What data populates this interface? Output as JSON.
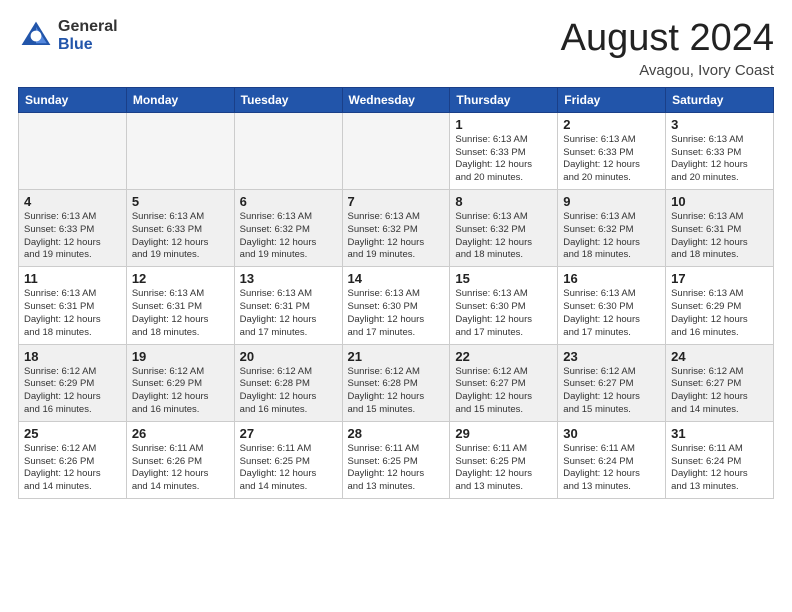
{
  "header": {
    "logo_general": "General",
    "logo_blue": "Blue",
    "month_year": "August 2024",
    "location": "Avagou, Ivory Coast"
  },
  "days_of_week": [
    "Sunday",
    "Monday",
    "Tuesday",
    "Wednesday",
    "Thursday",
    "Friday",
    "Saturday"
  ],
  "weeks": [
    {
      "shaded": false,
      "days": [
        {
          "num": "",
          "detail": ""
        },
        {
          "num": "",
          "detail": ""
        },
        {
          "num": "",
          "detail": ""
        },
        {
          "num": "",
          "detail": ""
        },
        {
          "num": "1",
          "detail": "Sunrise: 6:13 AM\nSunset: 6:33 PM\nDaylight: 12 hours\nand 20 minutes."
        },
        {
          "num": "2",
          "detail": "Sunrise: 6:13 AM\nSunset: 6:33 PM\nDaylight: 12 hours\nand 20 minutes."
        },
        {
          "num": "3",
          "detail": "Sunrise: 6:13 AM\nSunset: 6:33 PM\nDaylight: 12 hours\nand 20 minutes."
        }
      ]
    },
    {
      "shaded": true,
      "days": [
        {
          "num": "4",
          "detail": "Sunrise: 6:13 AM\nSunset: 6:33 PM\nDaylight: 12 hours\nand 19 minutes."
        },
        {
          "num": "5",
          "detail": "Sunrise: 6:13 AM\nSunset: 6:33 PM\nDaylight: 12 hours\nand 19 minutes."
        },
        {
          "num": "6",
          "detail": "Sunrise: 6:13 AM\nSunset: 6:32 PM\nDaylight: 12 hours\nand 19 minutes."
        },
        {
          "num": "7",
          "detail": "Sunrise: 6:13 AM\nSunset: 6:32 PM\nDaylight: 12 hours\nand 19 minutes."
        },
        {
          "num": "8",
          "detail": "Sunrise: 6:13 AM\nSunset: 6:32 PM\nDaylight: 12 hours\nand 18 minutes."
        },
        {
          "num": "9",
          "detail": "Sunrise: 6:13 AM\nSunset: 6:32 PM\nDaylight: 12 hours\nand 18 minutes."
        },
        {
          "num": "10",
          "detail": "Sunrise: 6:13 AM\nSunset: 6:31 PM\nDaylight: 12 hours\nand 18 minutes."
        }
      ]
    },
    {
      "shaded": false,
      "days": [
        {
          "num": "11",
          "detail": "Sunrise: 6:13 AM\nSunset: 6:31 PM\nDaylight: 12 hours\nand 18 minutes."
        },
        {
          "num": "12",
          "detail": "Sunrise: 6:13 AM\nSunset: 6:31 PM\nDaylight: 12 hours\nand 18 minutes."
        },
        {
          "num": "13",
          "detail": "Sunrise: 6:13 AM\nSunset: 6:31 PM\nDaylight: 12 hours\nand 17 minutes."
        },
        {
          "num": "14",
          "detail": "Sunrise: 6:13 AM\nSunset: 6:30 PM\nDaylight: 12 hours\nand 17 minutes."
        },
        {
          "num": "15",
          "detail": "Sunrise: 6:13 AM\nSunset: 6:30 PM\nDaylight: 12 hours\nand 17 minutes."
        },
        {
          "num": "16",
          "detail": "Sunrise: 6:13 AM\nSunset: 6:30 PM\nDaylight: 12 hours\nand 17 minutes."
        },
        {
          "num": "17",
          "detail": "Sunrise: 6:13 AM\nSunset: 6:29 PM\nDaylight: 12 hours\nand 16 minutes."
        }
      ]
    },
    {
      "shaded": true,
      "days": [
        {
          "num": "18",
          "detail": "Sunrise: 6:12 AM\nSunset: 6:29 PM\nDaylight: 12 hours\nand 16 minutes."
        },
        {
          "num": "19",
          "detail": "Sunrise: 6:12 AM\nSunset: 6:29 PM\nDaylight: 12 hours\nand 16 minutes."
        },
        {
          "num": "20",
          "detail": "Sunrise: 6:12 AM\nSunset: 6:28 PM\nDaylight: 12 hours\nand 16 minutes."
        },
        {
          "num": "21",
          "detail": "Sunrise: 6:12 AM\nSunset: 6:28 PM\nDaylight: 12 hours\nand 15 minutes."
        },
        {
          "num": "22",
          "detail": "Sunrise: 6:12 AM\nSunset: 6:27 PM\nDaylight: 12 hours\nand 15 minutes."
        },
        {
          "num": "23",
          "detail": "Sunrise: 6:12 AM\nSunset: 6:27 PM\nDaylight: 12 hours\nand 15 minutes."
        },
        {
          "num": "24",
          "detail": "Sunrise: 6:12 AM\nSunset: 6:27 PM\nDaylight: 12 hours\nand 14 minutes."
        }
      ]
    },
    {
      "shaded": false,
      "days": [
        {
          "num": "25",
          "detail": "Sunrise: 6:12 AM\nSunset: 6:26 PM\nDaylight: 12 hours\nand 14 minutes."
        },
        {
          "num": "26",
          "detail": "Sunrise: 6:11 AM\nSunset: 6:26 PM\nDaylight: 12 hours\nand 14 minutes."
        },
        {
          "num": "27",
          "detail": "Sunrise: 6:11 AM\nSunset: 6:25 PM\nDaylight: 12 hours\nand 14 minutes."
        },
        {
          "num": "28",
          "detail": "Sunrise: 6:11 AM\nSunset: 6:25 PM\nDaylight: 12 hours\nand 13 minutes."
        },
        {
          "num": "29",
          "detail": "Sunrise: 6:11 AM\nSunset: 6:25 PM\nDaylight: 12 hours\nand 13 minutes."
        },
        {
          "num": "30",
          "detail": "Sunrise: 6:11 AM\nSunset: 6:24 PM\nDaylight: 12 hours\nand 13 minutes."
        },
        {
          "num": "31",
          "detail": "Sunrise: 6:11 AM\nSunset: 6:24 PM\nDaylight: 12 hours\nand 13 minutes."
        }
      ]
    }
  ]
}
